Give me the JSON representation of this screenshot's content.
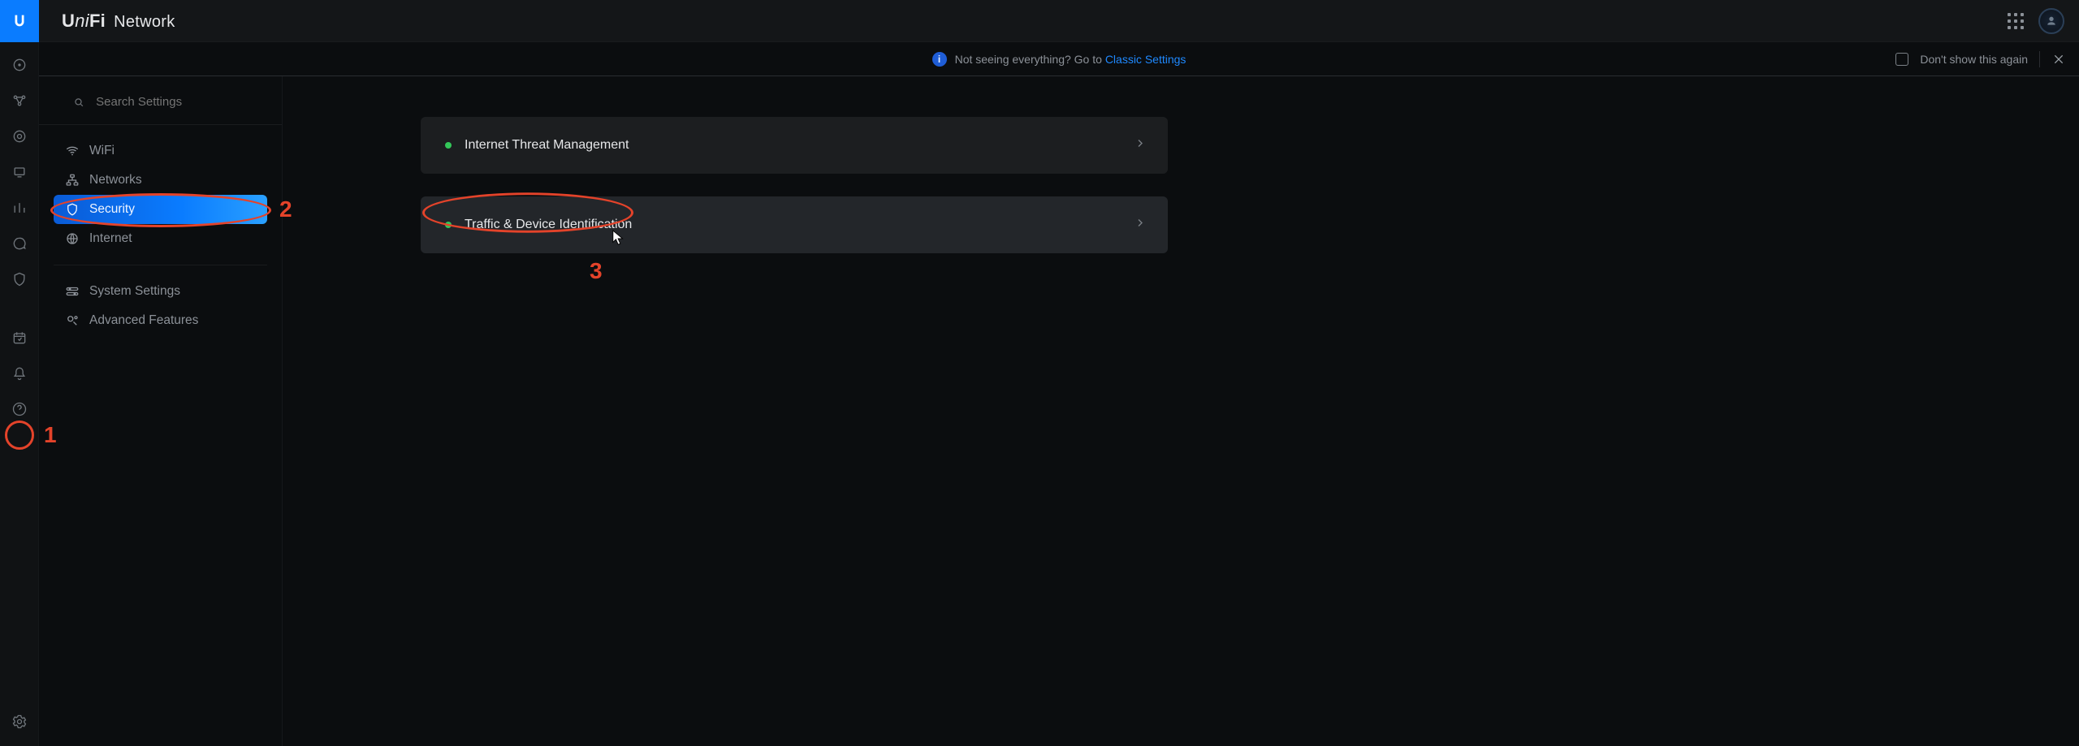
{
  "brand": {
    "logo_text": "UniFi",
    "subtitle": "Network"
  },
  "notice": {
    "text_prefix": "Not seeing everything? Go to ",
    "link_text": "Classic Settings",
    "dont_show": "Don't show this again"
  },
  "search": {
    "placeholder": "Search Settings"
  },
  "sidebar": {
    "items": [
      {
        "label": "WiFi",
        "icon": "wifi-icon"
      },
      {
        "label": "Networks",
        "icon": "network-icon"
      },
      {
        "label": "Security",
        "icon": "shield-icon",
        "active": true
      },
      {
        "label": "Internet",
        "icon": "globe-icon"
      }
    ],
    "items2": [
      {
        "label": "System Settings",
        "icon": "sliders-icon"
      },
      {
        "label": "Advanced Features",
        "icon": "advanced-icon"
      }
    ]
  },
  "cards": [
    {
      "title": "Internet Threat Management",
      "status": "green"
    },
    {
      "title": "Traffic & Device Identification",
      "status": "green"
    }
  ],
  "annotations": {
    "a1": "1",
    "a2": "2",
    "a3": "3"
  }
}
